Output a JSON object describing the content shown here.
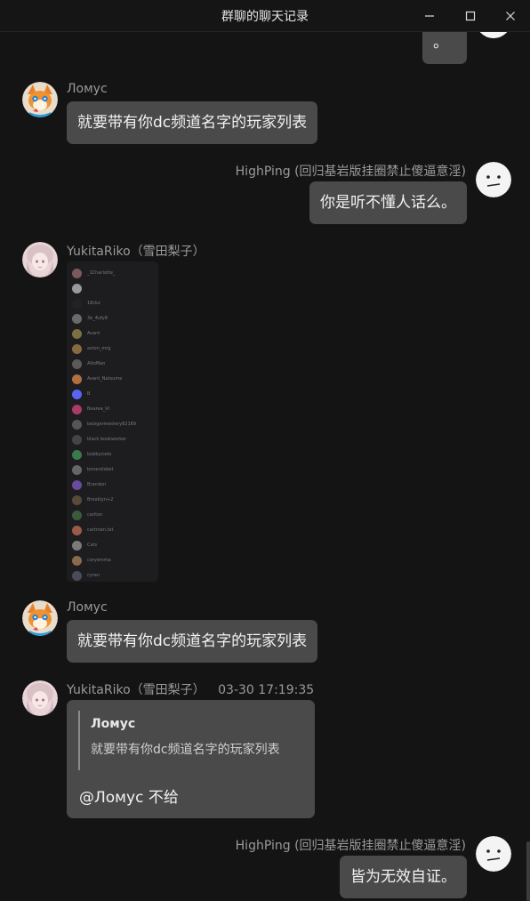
{
  "window": {
    "title": "群聊的聊天记录"
  },
  "messages": {
    "top_partial": {
      "text": "。"
    },
    "m1": {
      "sender": "Ломус",
      "text": "就要带有你dc频道名字的玩家列表"
    },
    "m2": {
      "sender": "HighPing (回归基岩版挂圈禁止傻逼意淫)",
      "text": "你是听不懂人话么。"
    },
    "m3": {
      "sender": "YukitaRiko（雪田梨子）"
    },
    "m4": {
      "sender": "Ломус",
      "text": "就要带有你dc频道名字的玩家列表"
    },
    "m5": {
      "sender": "YukitaRiko（雪田梨子）",
      "time": "03-30 17:19:35",
      "quote_name": "Ломус",
      "quote_text": "就要带有你dc频道名字的玩家列表",
      "reply": "@Ломус 不给"
    },
    "m6": {
      "sender": "HighPing (回归基岩版挂圈禁止傻逼意淫)",
      "text": "皆为无效自证。"
    }
  },
  "player_list": [
    {
      "name": "_1Charlotte_",
      "color": "#7a5a5a"
    },
    {
      "name": "",
      "color": "#9a9a9a"
    },
    {
      "name": "18ckz",
      "color": "#222222"
    },
    {
      "name": "3e_4ufy8",
      "color": "#6a6a6a"
    },
    {
      "name": "Avant",
      "color": "#7a7040"
    },
    {
      "name": "aston_mrg",
      "color": "#886a40"
    },
    {
      "name": "AltoMan",
      "color": "#5a5a5a"
    },
    {
      "name": "Avant_Natsume",
      "color": "#b07040"
    },
    {
      "name": "B",
      "color": "#5865F2"
    },
    {
      "name": "Bearea_Vi",
      "color": "#aa3a6a"
    },
    {
      "name": "beizgermestery82169",
      "color": "#555555"
    },
    {
      "name": "black bookworker",
      "color": "#444444"
    },
    {
      "name": "bobbycielo",
      "color": "#3a7a4a"
    },
    {
      "name": "bonersIsbet",
      "color": "#666666"
    },
    {
      "name": "Brandon",
      "color": "#6a4a9a"
    },
    {
      "name": "Brooklyn+2",
      "color": "#5a4a3a"
    },
    {
      "name": "carlton",
      "color": "#3a5a3a"
    },
    {
      "name": "cartmen.txt",
      "color": "#9a5a4a"
    },
    {
      "name": "Cats",
      "color": "#7a7a7a"
    },
    {
      "name": "coryemma",
      "color": "#8a6a4a"
    },
    {
      "name": "cyran",
      "color": "#4a4a5a"
    }
  ]
}
